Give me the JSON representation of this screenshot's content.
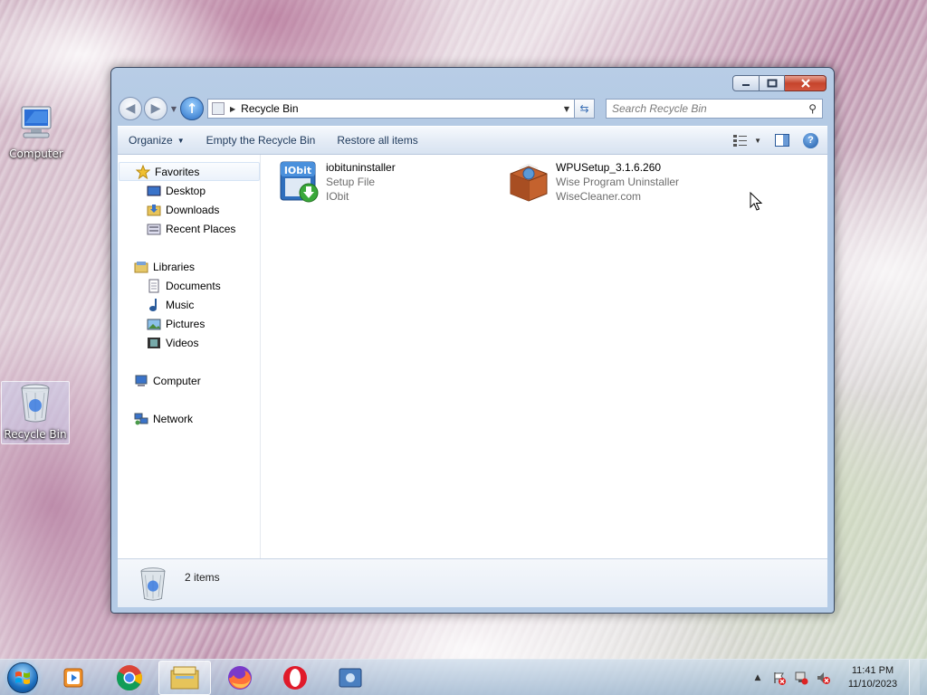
{
  "desktop": {
    "icons": [
      {
        "label": "Computer"
      },
      {
        "label": "Recycle Bin"
      }
    ]
  },
  "window": {
    "address": {
      "location": "Recycle Bin"
    },
    "search": {
      "placeholder": "Search Recycle Bin"
    },
    "toolbar": {
      "organize": "Organize",
      "empty": "Empty the Recycle Bin",
      "restore": "Restore all items"
    },
    "navpane": {
      "favorites": "Favorites",
      "desktop": "Desktop",
      "downloads": "Downloads",
      "recent": "Recent Places",
      "libraries": "Libraries",
      "documents": "Documents",
      "music": "Music",
      "pictures": "Pictures",
      "videos": "Videos",
      "computer": "Computer",
      "network": "Network"
    },
    "files": [
      {
        "name": "iobituninstaller",
        "type": "Setup File",
        "company": "IObit",
        "icon": "iobit-setup-icon"
      },
      {
        "name": "WPUSetup_3.1.6.260",
        "type": "Wise Program Uninstaller",
        "company": "WiseCleaner.com",
        "icon": "package-box-icon"
      }
    ],
    "details": {
      "count": "2 items"
    }
  },
  "taskbar": {
    "apps": [
      "media-player-icon",
      "chrome-icon",
      "explorer-icon",
      "firefox-icon",
      "opera-icon",
      "recycle-app-icon"
    ],
    "clock": {
      "time": "11:41 PM",
      "date": "11/10/2023"
    }
  },
  "colors": {
    "accent": "#1e395b",
    "window_frame": "#b8cde6",
    "selection": "#ebf2fb"
  }
}
